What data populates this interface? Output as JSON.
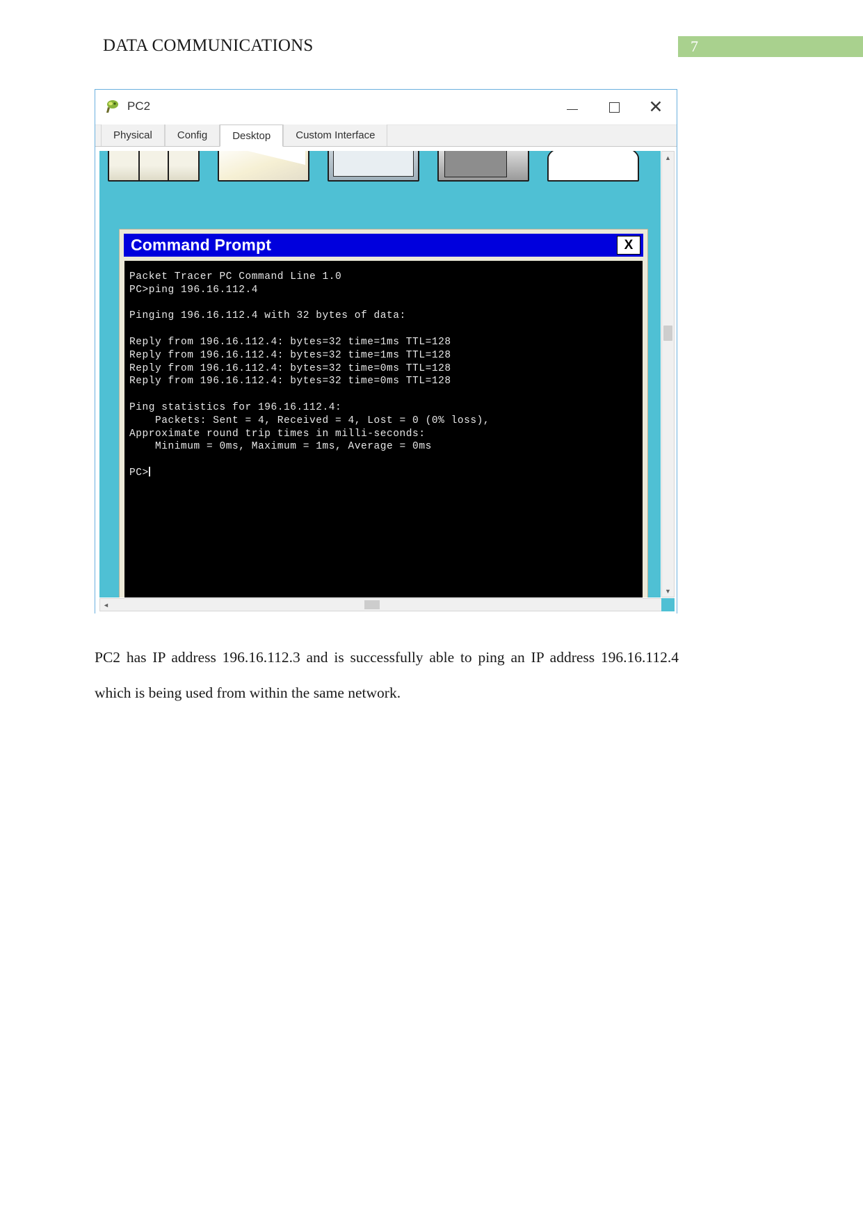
{
  "document": {
    "header_title": "DATA COMMUNICATIONS",
    "page_number": "7",
    "accent_color": "#a9d18e",
    "caption": "PC2 has IP address 196.16.112.3 and is successfully able to ping an IP address 196.16.112.4 which is being used from within the same network."
  },
  "pt_window": {
    "title": "PC2",
    "icon": "packet-tracer-icon",
    "window_buttons": {
      "minimize": "–",
      "maximize": "□",
      "close": "×"
    },
    "tabs": [
      {
        "label": "Physical",
        "active": false
      },
      {
        "label": "Config",
        "active": false
      },
      {
        "label": "Desktop",
        "active": true
      },
      {
        "label": "Custom Interface",
        "active": false
      }
    ]
  },
  "desktop": {
    "background_color": "#4fc0d4",
    "icons": [
      "desktop-app-icon-1",
      "desktop-app-icon-2",
      "desktop-app-icon-3",
      "desktop-app-icon-4",
      "desktop-app-icon-5"
    ]
  },
  "command_prompt": {
    "title": "Command Prompt",
    "titlebar_color": "#0000dd",
    "close_label": "X",
    "screen_color": "#000000",
    "text_color": "#e8e8e8",
    "lines": [
      "Packet Tracer PC Command Line 1.0",
      "PC>ping 196.16.112.4",
      "",
      "Pinging 196.16.112.4 with 32 bytes of data:",
      "",
      "Reply from 196.16.112.4: bytes=32 time=1ms TTL=128",
      "Reply from 196.16.112.4: bytes=32 time=1ms TTL=128",
      "Reply from 196.16.112.4: bytes=32 time=0ms TTL=128",
      "Reply from 196.16.112.4: bytes=32 time=0ms TTL=128",
      "",
      "Ping statistics for 196.16.112.4:",
      "    Packets: Sent = 4, Received = 4, Lost = 0 (0% loss),",
      "Approximate round trip times in milli-seconds:",
      "    Minimum = 0ms, Maximum = 1ms, Average = 0ms",
      "",
      "PC>"
    ],
    "ping_result": {
      "target_ip": "196.16.112.4",
      "source_ip": "196.16.112.3",
      "packet_size_bytes": 32,
      "sent": 4,
      "received": 4,
      "lost": 0,
      "loss_percent": "0%",
      "ttl": 128,
      "times_ms": [
        1,
        1,
        0,
        0
      ],
      "minimum_ms": "0ms",
      "maximum_ms": "1ms",
      "average_ms": "0ms"
    }
  },
  "scrollbars": {
    "vertical_up": "▲",
    "vertical_down": "▼",
    "horizontal_left": "◄",
    "horizontal_right": "►"
  }
}
